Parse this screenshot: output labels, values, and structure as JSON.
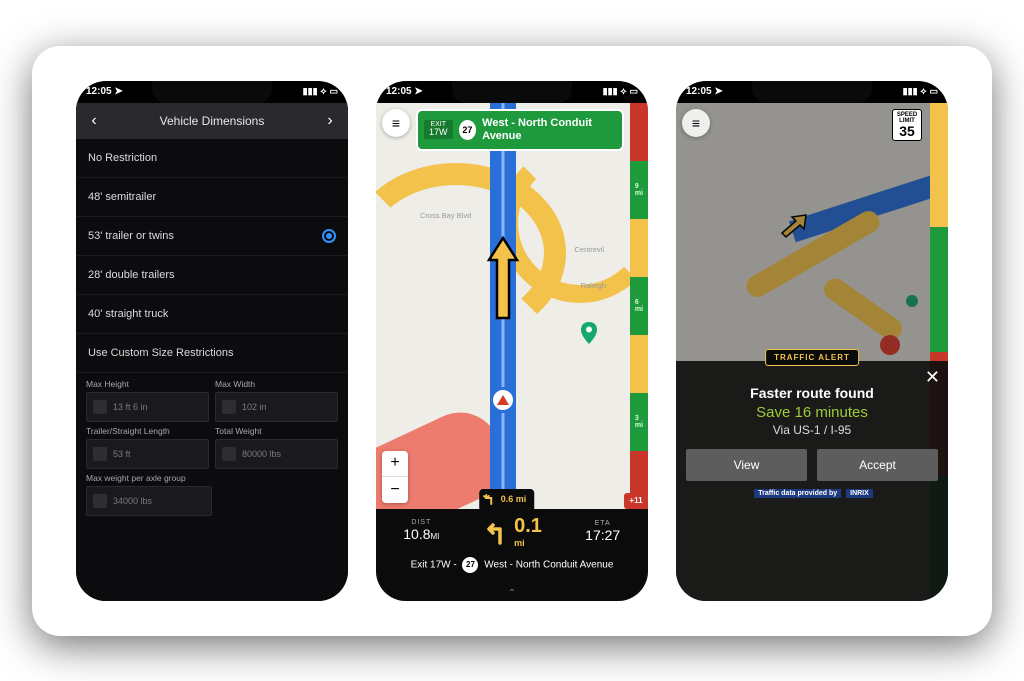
{
  "status": {
    "time": "12:05",
    "loc_icon": "➤",
    "signal_icon": "▮▮▮",
    "wifi_icon": "⟡",
    "batt_icon": "▭"
  },
  "phone1": {
    "header": "Vehicle Dimensions",
    "options": [
      {
        "label": "No Restriction",
        "selected": false
      },
      {
        "label": "48' semitrailer",
        "selected": false
      },
      {
        "label": "53' trailer or twins",
        "selected": true
      },
      {
        "label": "28' double trailers",
        "selected": false
      },
      {
        "label": "40' straight truck",
        "selected": false
      },
      {
        "label": "Use Custom Size Restrictions",
        "selected": false
      }
    ],
    "fields": [
      {
        "label": "Max Height",
        "value": "13 ft 6 in"
      },
      {
        "label": "Max Width",
        "value": "102 in"
      },
      {
        "label": "Trailer/Straight Length",
        "value": "53 ft"
      },
      {
        "label": "Total Weight",
        "value": "80000 lbs"
      },
      {
        "label": "Max weight per axle group",
        "value": "34000 lbs"
      }
    ]
  },
  "phone2": {
    "sign": {
      "exit_label": "EXIT",
      "exit_num": "17W",
      "shield": "27",
      "road": "West - North Conduit Avenue"
    },
    "pre_next": "0.6 mi",
    "zoom_in": "+",
    "zoom_out": "−",
    "side_badge": "+11",
    "bottom": {
      "dist_label": "DIST",
      "dist_value": "10.8",
      "dist_unit": "MI",
      "turn_value": "0.1",
      "turn_unit": "mi",
      "eta_label": "ETA",
      "eta_value": "17:27",
      "next_text_a": "Exit 17W -",
      "next_shield": "27",
      "next_text_b": "West - North Conduit Avenue"
    },
    "labels": {
      "l1": "Cross Bay Blvd",
      "l2": "Centrevil",
      "l3": "Raleigh"
    }
  },
  "phone3": {
    "speed": {
      "label": "SPEED LIMIT",
      "value": "35"
    },
    "alert_pill": "TRAFFIC ALERT",
    "panel": {
      "title": "Faster route found",
      "save": "Save 16 minutes",
      "via": "Via US-1 / I-95",
      "view": "View",
      "accept": "Accept",
      "credit_text": "Traffic data provided by",
      "credit_brand": "INRIX"
    }
  }
}
